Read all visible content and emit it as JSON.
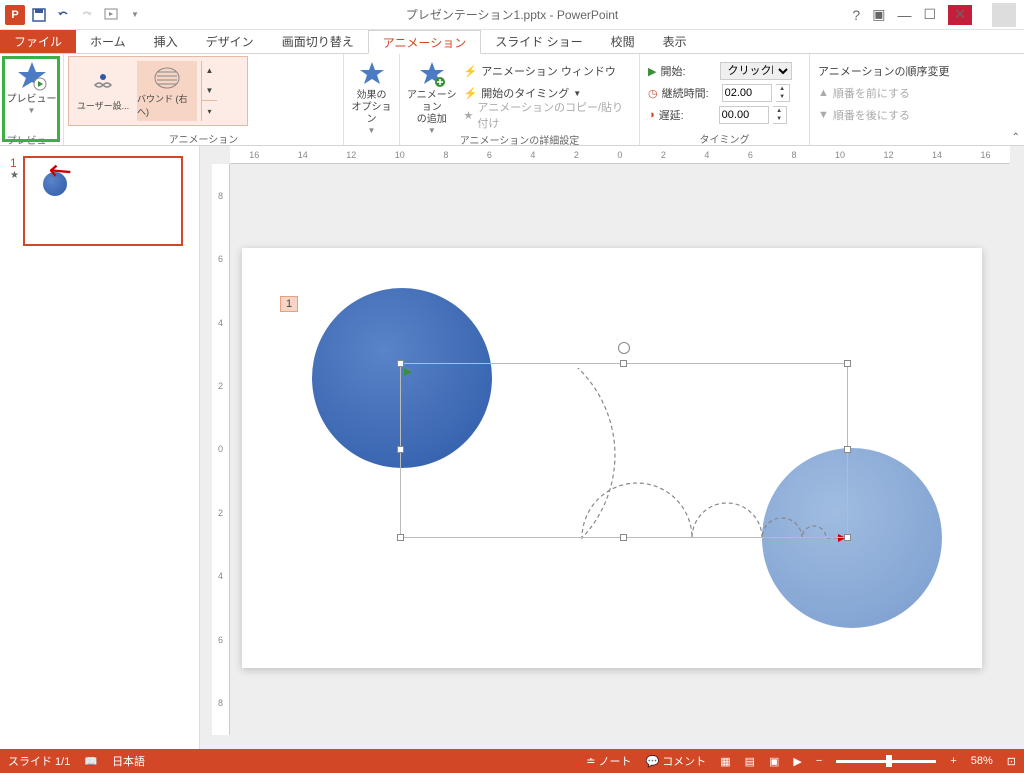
{
  "title": "プレゼンテーション1.pptx - PowerPoint",
  "tabs": {
    "file": "ファイル",
    "home": "ホーム",
    "insert": "挿入",
    "design": "デザイン",
    "transitions": "画面切り替え",
    "animations": "アニメーション",
    "slideshow": "スライド ショー",
    "review": "校閲",
    "view": "表示"
  },
  "ribbon": {
    "preview": {
      "label": "プレビュー",
      "group": "プレビュー"
    },
    "gallery": {
      "user_setting": "ユーザー設...",
      "bound_right": "バウンド (右へ)",
      "group": "アニメーション"
    },
    "effect_options": "効果の\nオプション",
    "add_animation": "アニメーション\nの追加",
    "advanced": {
      "pane": "アニメーション ウィンドウ",
      "trigger": "開始のタイミング",
      "copy": "アニメーションのコピー/貼り付け",
      "group": "アニメーションの詳細設定"
    },
    "timing": {
      "start_label": "開始:",
      "start_value": "クリック時",
      "duration_label": "継続時間:",
      "duration_value": "02.00",
      "delay_label": "遅延:",
      "delay_value": "00.00",
      "group": "タイミング"
    },
    "reorder": {
      "title": "アニメーションの順序変更",
      "earlier": "順番を前にする",
      "later": "順番を後にする"
    }
  },
  "slide_panel": {
    "num": "1",
    "star": "★"
  },
  "canvas": {
    "anim_tag": "1"
  },
  "status": {
    "slide": "スライド 1/1",
    "lang": "日本語",
    "notes": "ノート",
    "comments": "コメント",
    "zoom": "58%"
  },
  "ruler_h": [
    "16",
    "14",
    "12",
    "10",
    "8",
    "6",
    "4",
    "2",
    "0",
    "2",
    "4",
    "6",
    "8",
    "10",
    "12",
    "14",
    "16"
  ],
  "ruler_v": [
    "8",
    "6",
    "4",
    "2",
    "0",
    "2",
    "4",
    "6",
    "8"
  ]
}
